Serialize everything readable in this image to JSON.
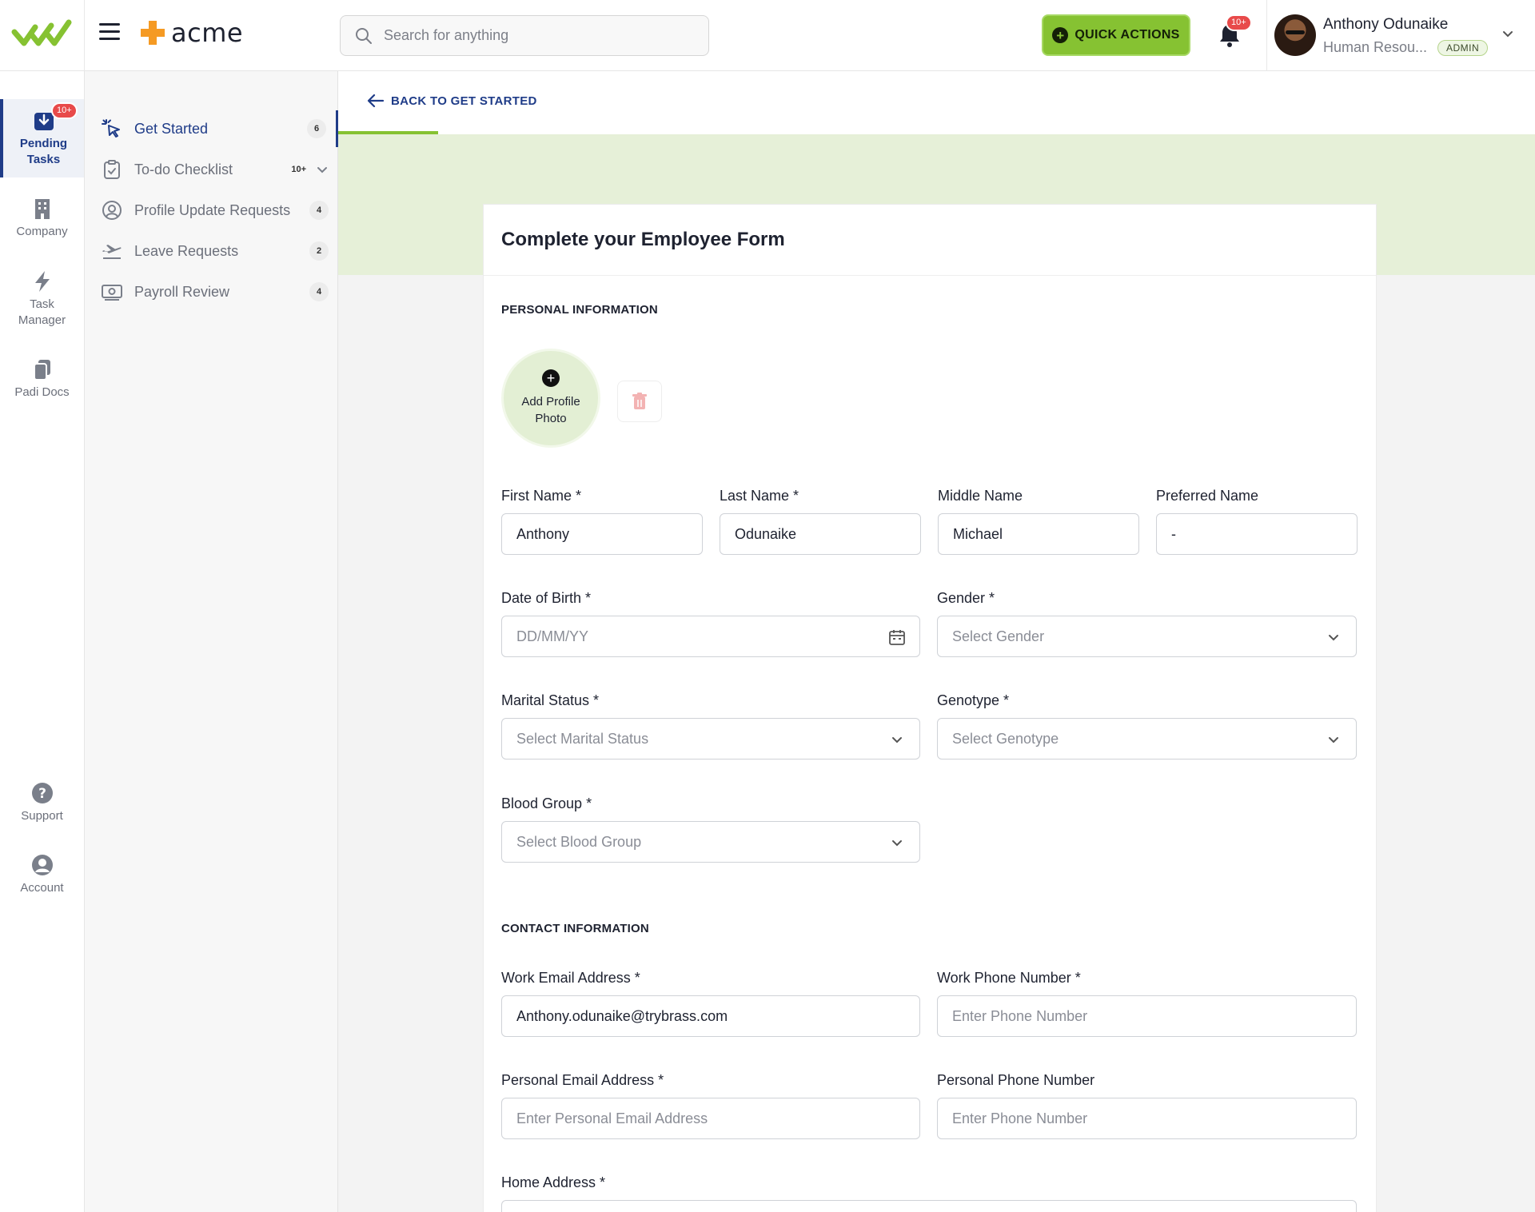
{
  "header": {
    "brand_name": "acme",
    "search_placeholder": "Search for anything",
    "quick_actions_label": "QUICK ACTIONS",
    "notifications_badge": "10+",
    "user_name": "Anthony Odunaike",
    "user_role": "Human Resou...",
    "user_badge": "ADMIN"
  },
  "leftnav": {
    "items": [
      {
        "label_line1": "Pending",
        "label_line2": "Tasks",
        "badge": "10+",
        "icon": "download-tray-icon",
        "active": true
      },
      {
        "label_line1": "Company",
        "label_line2": "",
        "icon": "building-icon"
      },
      {
        "label_line1": "Task",
        "label_line2": "Manager",
        "icon": "lightning-icon"
      },
      {
        "label_line1": "Padi Docs",
        "label_line2": "",
        "icon": "documents-icon"
      },
      {
        "label_line1": "Support",
        "label_line2": "",
        "icon": "help-circle-icon"
      },
      {
        "label_line1": "Account",
        "label_line2": "",
        "icon": "user-circle-icon"
      }
    ]
  },
  "subnav": {
    "items": [
      {
        "label": "Get Started",
        "count": "6",
        "icon": "cursor-click-icon",
        "active": true
      },
      {
        "label": "To-do Checklist",
        "count": "10+",
        "icon": "clipboard-check-icon"
      },
      {
        "label": "Profile Update Requests",
        "count": "4",
        "icon": "user-circle-icon"
      },
      {
        "label": "Leave Requests",
        "count": "2",
        "icon": "airplane-icon"
      },
      {
        "label": "Payroll Review",
        "count": "4",
        "icon": "money-icon"
      }
    ]
  },
  "main": {
    "back_label": "BACK TO GET STARTED",
    "form_title": "Complete your Employee Form",
    "personal_section": "PERSONAL INFORMATION",
    "photo_label": "Add Profile Photo",
    "fields": {
      "first_name": {
        "label": "First Name *",
        "value": "Anthony"
      },
      "last_name": {
        "label": "Last Name *",
        "value": "Odunaike"
      },
      "middle_name": {
        "label": "Middle Name",
        "value": "Michael"
      },
      "preferred_name": {
        "label": "Preferred Name",
        "value": "-"
      },
      "dob": {
        "label": "Date of Birth *",
        "placeholder": "DD/MM/YY"
      },
      "gender": {
        "label": "Gender *",
        "placeholder": "Select Gender"
      },
      "marital": {
        "label": "Marital Status *",
        "placeholder": "Select Marital Status"
      },
      "genotype": {
        "label": "Genotype *",
        "placeholder": "Select Genotype"
      },
      "blood": {
        "label": "Blood Group *",
        "placeholder": "Select Blood Group"
      },
      "work_email": {
        "label": "Work Email Address *",
        "value": "Anthony.odunaike@trybrass.com"
      },
      "work_phone": {
        "label": "Work Phone Number *",
        "placeholder": "Enter Phone Number"
      },
      "personal_email": {
        "label": "Personal Email Address *",
        "placeholder": "Enter Personal Email Address"
      },
      "personal_phone": {
        "label": "Personal Phone Number",
        "placeholder": "Enter Phone Number"
      },
      "home_address": {
        "label": "Home Address *"
      }
    },
    "contact_section": "CONTACT INFORMATION"
  },
  "colors": {
    "brand_green": "#86c232",
    "nav_blue": "#1f3c88",
    "band_green": "#e6f0d8",
    "badge_red": "#e84a4a",
    "acme_orange": "#f59a23"
  }
}
